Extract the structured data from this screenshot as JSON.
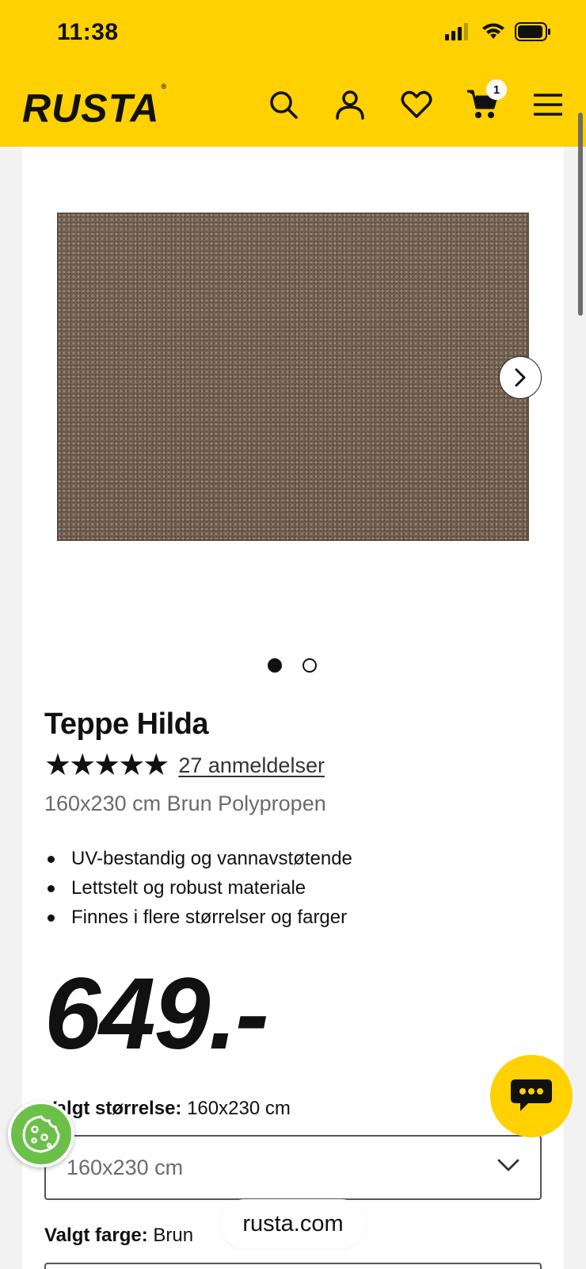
{
  "status_bar": {
    "time": "11:38"
  },
  "header": {
    "logo_text": "RUSTA",
    "logo_mark": "®",
    "cart_count": "1",
    "icons": [
      "search-icon",
      "account-icon",
      "heart-icon",
      "cart-icon",
      "menu-icon"
    ],
    "brand_color": "#ffd100"
  },
  "gallery": {
    "image_count": 2,
    "active_index": 0
  },
  "product": {
    "title": "Teppe Hilda",
    "stars": "★★★★★",
    "rating": 5,
    "reviews_link": "27 anmeldelser",
    "subtitle": "160x230 cm Brun Polypropen",
    "bullets": [
      "UV-bestandig og vannavstøtende",
      "Lettstelt og robust materiale",
      "Finnes i flere størrelser og farger"
    ],
    "price": "649.-"
  },
  "size": {
    "label": "Valgt størrelse:",
    "value": "160x230 cm",
    "select_value": "160x230 cm"
  },
  "color": {
    "label": "Valgt farge:",
    "value": "Brun"
  },
  "browser": {
    "url": "rusta.com"
  }
}
